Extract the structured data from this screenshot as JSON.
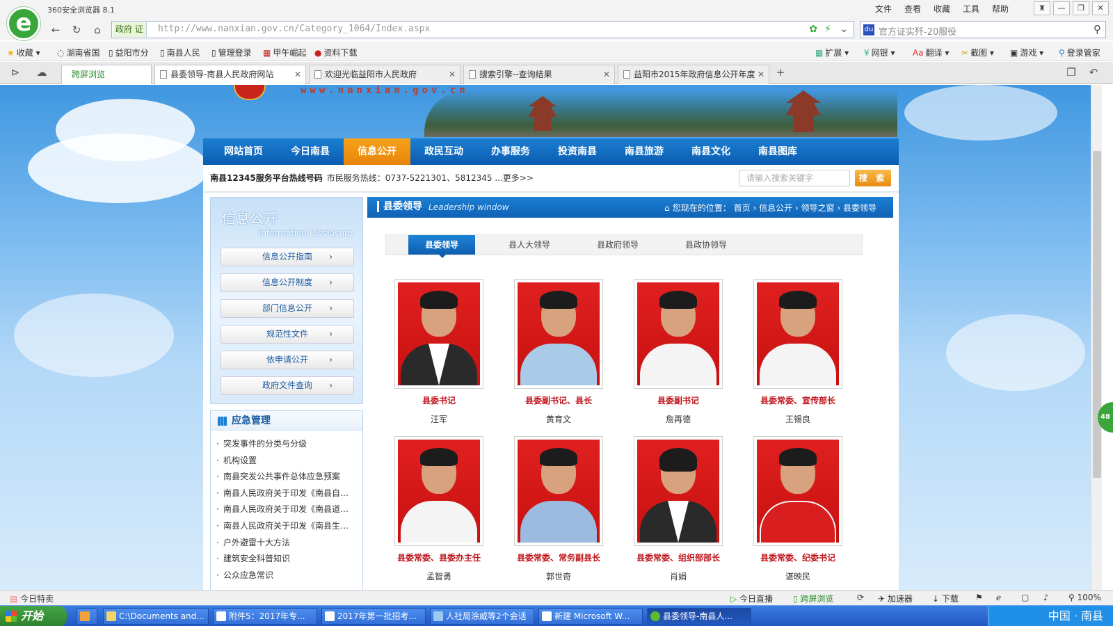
{
  "browser": {
    "window_title": "360安全浏览器 8.1",
    "menu": [
      "文件",
      "查看",
      "收藏",
      "工具",
      "帮助"
    ],
    "gov_badge": "政府 证",
    "url_host": "http://www.nanxian.gov.cn",
    "url_path": "/Category_1064/Index.aspx",
    "search_placeholder": "官方证实歼-20服役",
    "bookmarks": [
      "收藏",
      "湖南省国",
      "益阳市分",
      "南县人民",
      "管理登录",
      "甲午崛起",
      "资料下载"
    ],
    "toolbar_right": [
      "扩展",
      "网银",
      "翻译",
      "截图",
      "游戏",
      "登录管家"
    ],
    "tabs": [
      {
        "label": "跨屏浏览"
      },
      {
        "label": "县委领导-南县人民政府网站"
      },
      {
        "label": "欢迎光临益阳市人民政府"
      },
      {
        "label": "搜索引擎--查询结果"
      },
      {
        "label": "益阳市2015年政府信息公开年度"
      }
    ]
  },
  "site": {
    "domain_banner": "www.nanxian.gov.cn",
    "nav": [
      "网站首页",
      "今日南县",
      "信息公开",
      "政民互动",
      "办事服务",
      "投资南县",
      "南县旅游",
      "南县文化",
      "南县图库"
    ],
    "active_nav_index": 2,
    "hotline_label": "南县12345服务平台热线号码",
    "hotline_text": "市民服务热线：0737-5221301、5812345 ...",
    "hotline_more": "更多>>",
    "site_search_placeholder": "请输入搜索关键字",
    "site_search_button": "搜 索"
  },
  "sidebar": {
    "title": "信息公开",
    "subtitle": "Information Disclosure",
    "items": [
      "信息公开指南",
      "信息公开制度",
      "部门信息公开",
      "规范性文件",
      "依申请公开",
      "政府文件查询"
    ]
  },
  "emergency": {
    "title": "应急管理",
    "items": [
      "突发事件的分类与分级",
      "机构设置",
      "南县突发公共事件总体应急预案",
      "南县人民政府关于印发《南县自…",
      "南县人民政府关于印发《南县道…",
      "南县人民政府关于印发《南县生…",
      "户外避雷十大方法",
      "建筑安全科普知识",
      "公众应急常识"
    ]
  },
  "panel": {
    "title": "县委领导",
    "title_en": "Leadership window",
    "breadcrumb_prefix": "您现在的位置：",
    "breadcrumb": [
      "首页",
      "信息公开",
      "领导之窗",
      "县委领导"
    ],
    "subtabs": [
      "县委领导",
      "县人大领导",
      "县政府领导",
      "县政协领导"
    ],
    "active_subtab": 0
  },
  "leaders": [
    {
      "role": "县委书记",
      "name": "汪军"
    },
    {
      "role": "县委副书记、县长",
      "name": "黄育文"
    },
    {
      "role": "县委副书记",
      "name": "詹再德"
    },
    {
      "role": "县委常委、宣传部长",
      "name": "王锡良"
    },
    {
      "role": "县委常委、县委办主任",
      "name": "孟智勇"
    },
    {
      "role": "县委常委、常务副县长",
      "name": "郭世奇"
    },
    {
      "role": "县委常委、组织部部长",
      "name": "肖娟"
    },
    {
      "role": "县委常委、纪委书记",
      "name": "谌映民"
    }
  ],
  "statusbar": {
    "left": "今日特卖",
    "right": [
      "今日直播",
      "跨屏浏览",
      "加速器",
      "下载",
      "100%"
    ]
  },
  "taskbar": {
    "start": "开始",
    "tasks": [
      "C:\\Documents and...",
      "附件5：2017年专...",
      "2017年第一批招考...",
      "人社局涂威等2个会话",
      "新建 Microsoft W...",
      "县委领导-南县人..."
    ],
    "tray_text": "中国 · 南县"
  },
  "float_badge": "48"
}
